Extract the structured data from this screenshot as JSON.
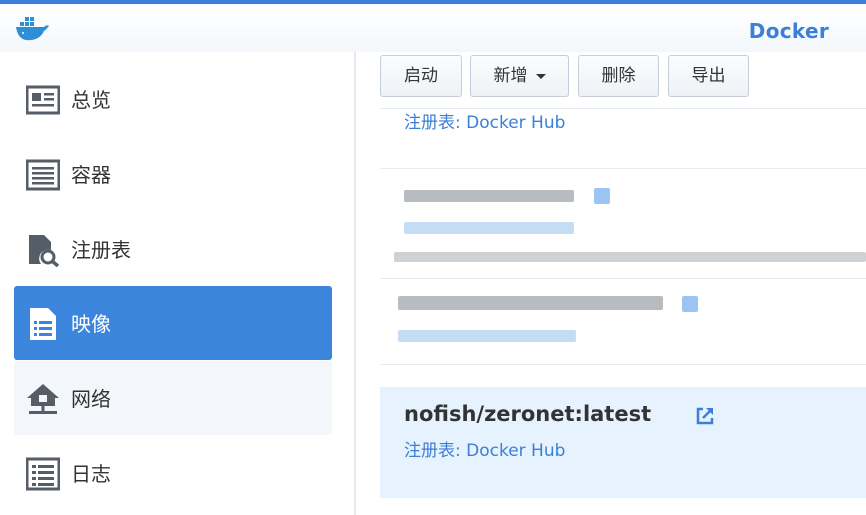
{
  "app": {
    "title": "Docker",
    "accent_color": "#3b7fd6",
    "logo_icon": "docker-whale-icon"
  },
  "sidebar": {
    "items": [
      {
        "label": "总览",
        "icon": "overview-card-icon"
      },
      {
        "label": "容器",
        "icon": "container-list-icon"
      },
      {
        "label": "注册表",
        "icon": "registry-search-icon"
      },
      {
        "label": "映像",
        "icon": "image-document-icon",
        "active": true
      },
      {
        "label": "网络",
        "icon": "network-house-icon"
      },
      {
        "label": "日志",
        "icon": "log-list-icon"
      }
    ]
  },
  "toolbar": {
    "launch_label": "启动",
    "add_label": "新增",
    "delete_label": "删除",
    "export_label": "导出"
  },
  "images": [
    {
      "registry": "注册表: Docker Hub"
    },
    {
      "name": "nofish/zeronet:latest",
      "registry": "注册表: Docker Hub",
      "selected": true,
      "link_icon": "external-link-icon"
    }
  ]
}
